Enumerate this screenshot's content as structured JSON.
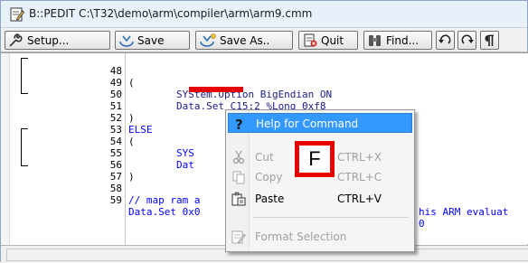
{
  "window": {
    "title": "B::PEDIT C:\\T32\\demo\\arm\\compiler\\arm\\arm9.cmm"
  },
  "toolbar": {
    "buttons": [
      {
        "label": "Setup...",
        "icon": "wrench-icon"
      },
      {
        "label": "Save",
        "icon": "save-icon"
      },
      {
        "label": "Save As..",
        "icon": "save-as-icon"
      },
      {
        "label": "Quit",
        "icon": "quit-icon"
      },
      {
        "label": "Find...",
        "icon": "binoculars-icon"
      },
      {
        "label": "",
        "icon": "undo-icon"
      },
      {
        "label": "",
        "icon": "redo-icon"
      },
      {
        "label": "",
        "icon": "pilcrow-icon"
      }
    ]
  },
  "editor": {
    "lines": [
      {
        "num": "48",
        "text": "("
      },
      {
        "num": "49",
        "text": "        SYStem.Option BigEndian ON"
      },
      {
        "num": "50",
        "text": "        Data.Set C15:2 %Long 0xf8"
      },
      {
        "num": "51",
        "text": ")"
      },
      {
        "num": "52",
        "text": "ELSE"
      },
      {
        "num": "53",
        "text": "("
      },
      {
        "num": "54",
        "text": "        SYS"
      },
      {
        "num": "55",
        "text": "        Dat"
      },
      {
        "num": "56",
        "text": ")"
      },
      {
        "num": "57",
        "text": ""
      },
      {
        "num": "58",
        "text": "// map ram a",
        "text_right": "his ARM evaluat"
      },
      {
        "num": "59",
        "text": "Data.Set 0x0",
        "text_right": "0"
      }
    ]
  },
  "context_menu": {
    "items": [
      {
        "label": "Help for Command",
        "accel": "",
        "icon": "help-icon",
        "enabled": true,
        "highlighted": true
      },
      {
        "label": "Cut",
        "accel": "CTRL+X",
        "icon": "scissors-icon",
        "enabled": false
      },
      {
        "label": "Copy",
        "accel": "CTRL+C",
        "icon": "copy-icon",
        "enabled": false
      },
      {
        "label": "Paste",
        "accel": "CTRL+V",
        "icon": "paste-icon",
        "enabled": true
      },
      {
        "label": "Format Selection",
        "accel": "",
        "icon": "format-icon",
        "enabled": false
      }
    ]
  },
  "callout": {
    "letter": "F",
    "color": "#e80000"
  },
  "colors": {
    "keyword": "#0000ff",
    "highlight": "#3399ff",
    "annotation": "#e80000"
  }
}
